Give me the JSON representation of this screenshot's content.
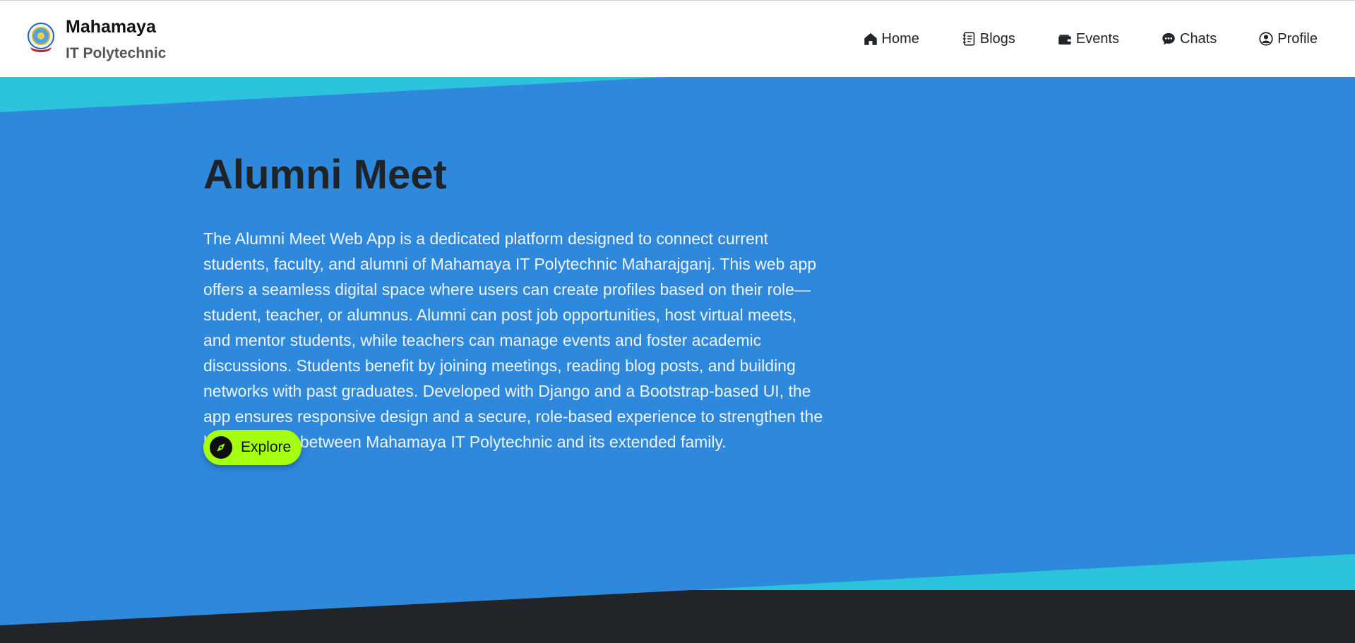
{
  "brand": {
    "title": "Mahamaya",
    "subtitle": "IT Polytechnic",
    "logo_icon": "college-emblem-logo"
  },
  "nav": {
    "items": [
      {
        "label": "Home",
        "icon": "home-icon"
      },
      {
        "label": "Blogs",
        "icon": "journal-icon"
      },
      {
        "label": "Events",
        "icon": "wallet-icon"
      },
      {
        "label": "Chats",
        "icon": "chat-dots-icon"
      },
      {
        "label": "Profile",
        "icon": "person-circle-icon"
      }
    ]
  },
  "hero": {
    "title": "Alumni Meet",
    "description": "The Alumni Meet Web App is a dedicated platform designed to connect current students, faculty, and alumni of Mahamaya IT Polytechnic Maharajganj. This web app offers a seamless digital space where users can create profiles based on their role—student, teacher, or alumnus. Alumni can post job opportunities, host virtual meets, and mentor students, while teachers can manage events and foster academic discussions. Students benefit by joining meetings, reading blog posts, and building networks with past graduates. Developed with Django and a Bootstrap-based UI, the app ensures responsive design and a secure, role-based experience to strengthen the lifelong bond between Mahamaya IT Polytechnic and its extended family.",
    "explore_label": "Explore",
    "explore_icon": "compass-icon"
  },
  "colors": {
    "hero_blue": "#2e88dc",
    "accent_cyan": "#2bc2dc",
    "footer_dark": "#212529",
    "button_green": "#a4ff10"
  }
}
